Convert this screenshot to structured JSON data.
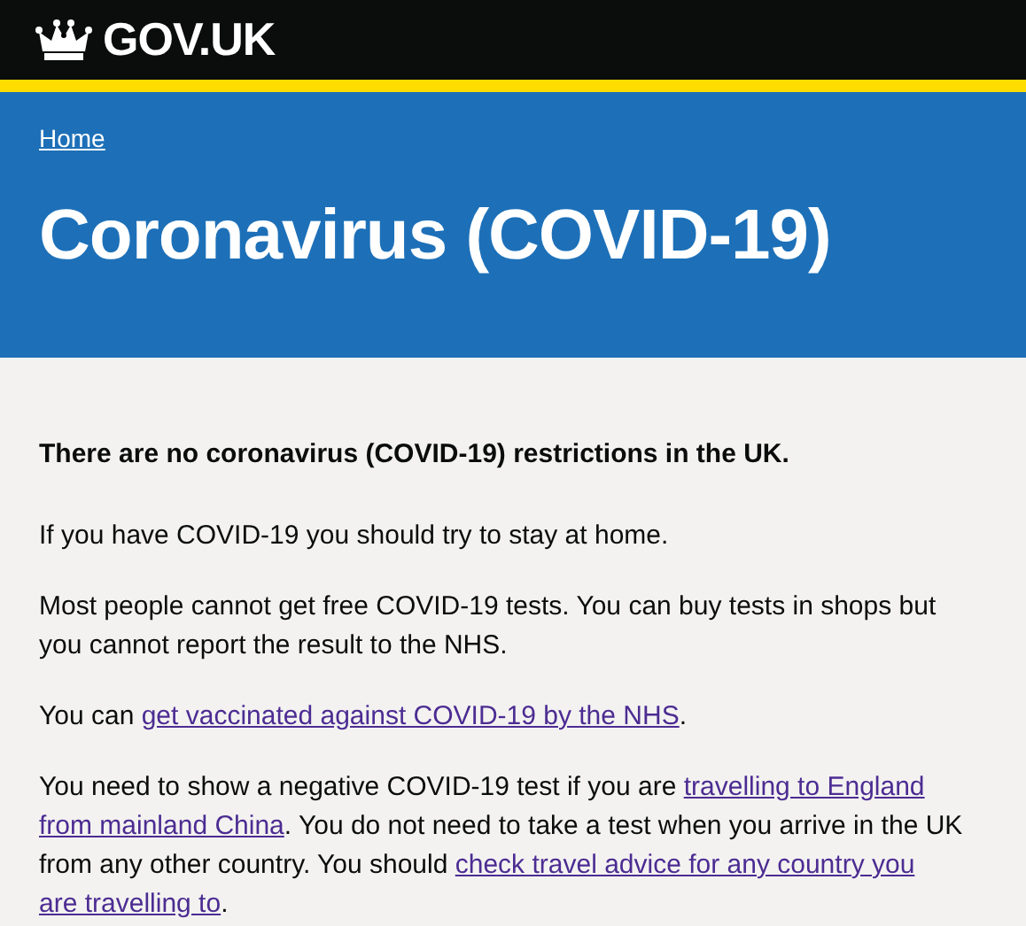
{
  "header": {
    "logo_text": "GOV.UK"
  },
  "breadcrumb": {
    "link": "Home"
  },
  "title": "Coronavirus (COVID-19)",
  "paragraphs": [
    {
      "kind": "lead",
      "lines": [
        [
          {
            "kind": "text",
            "text": "There are no coronavirus (COVID-19) restrictions in the UK."
          }
        ]
      ]
    },
    {
      "kind": "body",
      "lines": [
        [
          {
            "kind": "text",
            "text": "If you have COVID-19 you should try to stay at home."
          }
        ]
      ]
    },
    {
      "kind": "body",
      "lines": [
        [
          {
            "kind": "text",
            "text": "Most people cannot get free COVID-19 tests. You can buy tests in shops but"
          }
        ],
        [
          {
            "kind": "text",
            "text": "you cannot report the result to the NHS."
          }
        ]
      ]
    },
    {
      "kind": "body",
      "lines": [
        [
          {
            "kind": "text",
            "text": "You can "
          },
          {
            "kind": "link",
            "text": "get vaccinated against COVID-19 by the NHS"
          },
          {
            "kind": "text",
            "text": "."
          }
        ]
      ]
    },
    {
      "kind": "body",
      "lines": [
        [
          {
            "kind": "text",
            "text": "You need to show a negative COVID-19 test if you are "
          },
          {
            "kind": "link",
            "text": "travelling to England"
          }
        ],
        [
          {
            "kind": "link",
            "text": "from mainland China"
          },
          {
            "kind": "text",
            "text": ". You do not need to take a test when you arrive in the UK"
          }
        ],
        [
          {
            "kind": "text",
            "text": "from any other country. You should "
          },
          {
            "kind": "link",
            "text": "check travel advice for any country you"
          }
        ],
        [
          {
            "kind": "link",
            "text": "are travelling to"
          },
          {
            "kind": "text",
            "text": "."
          }
        ]
      ]
    }
  ]
}
